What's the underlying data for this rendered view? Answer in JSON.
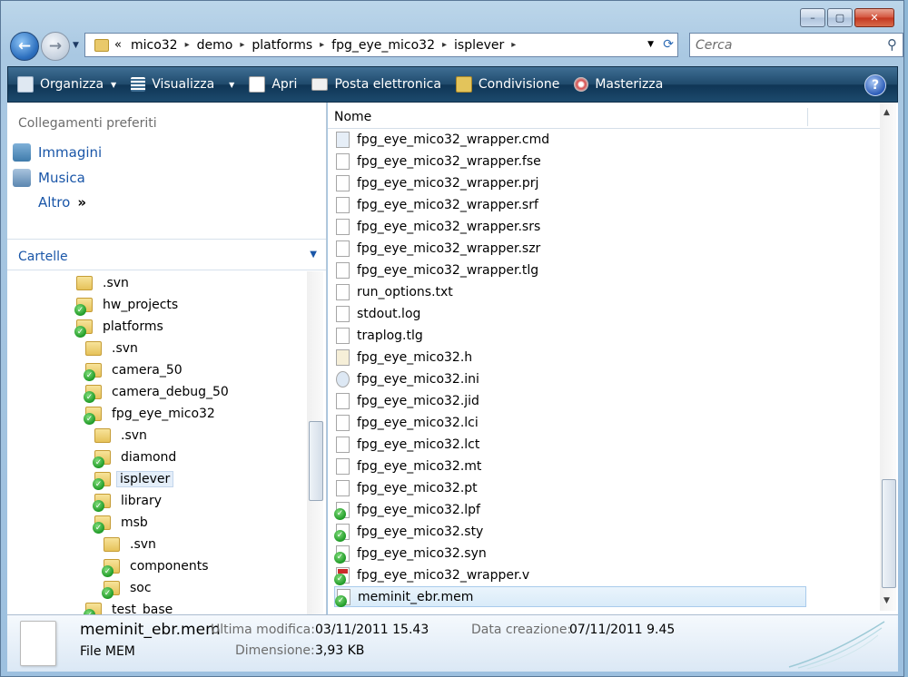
{
  "window": {
    "caption": {
      "minimize": "–",
      "maximize": "▢",
      "close": "✕"
    }
  },
  "nav": {
    "back_glyph": "←",
    "forward_glyph": "→",
    "address": {
      "root_marker": "«",
      "crumbs": [
        "mico32",
        "demo",
        "platforms",
        "fpg_eye_mico32",
        "isplever"
      ],
      "separator": "▸"
    },
    "refresh_glyph": "⟳",
    "search_placeholder": "Cerca"
  },
  "toolbar": {
    "items": [
      {
        "label": "Organizza",
        "icon": "organize-icon",
        "has_menu": true
      },
      {
        "label": "Visualizza",
        "icon": "views-icon",
        "has_menu": true
      },
      {
        "label": "Apri",
        "icon": "open-icon",
        "has_menu": false
      },
      {
        "label": "Posta elettronica",
        "icon": "email-icon",
        "has_menu": false
      },
      {
        "label": "Condivisione",
        "icon": "share-icon",
        "has_menu": false
      },
      {
        "label": "Masterizza",
        "icon": "burn-icon",
        "has_menu": false
      }
    ],
    "help": "?"
  },
  "sidebar": {
    "favorites_header": "Collegamenti preferiti",
    "favorites": [
      {
        "label": "Immagini",
        "icon": "pictures-icon"
      },
      {
        "label": "Musica",
        "icon": "music-icon"
      },
      {
        "label": "Altro",
        "icon": "more-chevron-icon",
        "suffix": "»"
      }
    ],
    "folders_header": "Cartelle",
    "tree": [
      {
        "label": ".svn",
        "depth": 0,
        "svn_ok": false
      },
      {
        "label": "hw_projects",
        "depth": 0,
        "svn_ok": true
      },
      {
        "label": "platforms",
        "depth": 0,
        "svn_ok": true
      },
      {
        "label": ".svn",
        "depth": 1,
        "svn_ok": false
      },
      {
        "label": "camera_50",
        "depth": 1,
        "svn_ok": true
      },
      {
        "label": "camera_debug_50",
        "depth": 1,
        "svn_ok": true
      },
      {
        "label": "fpg_eye_mico32",
        "depth": 1,
        "svn_ok": true
      },
      {
        "label": ".svn",
        "depth": 2,
        "svn_ok": false
      },
      {
        "label": "diamond",
        "depth": 2,
        "svn_ok": true
      },
      {
        "label": "isplever",
        "depth": 2,
        "svn_ok": true,
        "selected": true
      },
      {
        "label": "library",
        "depth": 2,
        "svn_ok": true
      },
      {
        "label": "msb",
        "depth": 2,
        "svn_ok": true
      },
      {
        "label": ".svn",
        "depth": 3,
        "svn_ok": false
      },
      {
        "label": "components",
        "depth": 3,
        "svn_ok": true
      },
      {
        "label": "soc",
        "depth": 3,
        "svn_ok": true
      },
      {
        "label": "test_base",
        "depth": 1,
        "svn_ok": true
      }
    ]
  },
  "filelist": {
    "column_name": "Nome",
    "files": [
      {
        "name": "fpg_eye_mico32_wrapper.cmd",
        "kind": "cmd"
      },
      {
        "name": "fpg_eye_mico32_wrapper.fse",
        "kind": "plain"
      },
      {
        "name": "fpg_eye_mico32_wrapper.prj",
        "kind": "plain"
      },
      {
        "name": "fpg_eye_mico32_wrapper.srf",
        "kind": "plain"
      },
      {
        "name": "fpg_eye_mico32_wrapper.srs",
        "kind": "plain"
      },
      {
        "name": "fpg_eye_mico32_wrapper.szr",
        "kind": "plain"
      },
      {
        "name": "fpg_eye_mico32_wrapper.tlg",
        "kind": "plain"
      },
      {
        "name": "run_options.txt",
        "kind": "plain"
      },
      {
        "name": "stdout.log",
        "kind": "plain"
      },
      {
        "name": "traplog.tlg",
        "kind": "plain"
      },
      {
        "name": "fpg_eye_mico32.h",
        "kind": "h"
      },
      {
        "name": "fpg_eye_mico32.ini",
        "kind": "ini"
      },
      {
        "name": "fpg_eye_mico32.jid",
        "kind": "plain"
      },
      {
        "name": "fpg_eye_mico32.lci",
        "kind": "plain"
      },
      {
        "name": "fpg_eye_mico32.lct",
        "kind": "plain"
      },
      {
        "name": "fpg_eye_mico32.mt",
        "kind": "plain"
      },
      {
        "name": "fpg_eye_mico32.pt",
        "kind": "plain"
      },
      {
        "name": "fpg_eye_mico32.lpf",
        "kind": "svn"
      },
      {
        "name": "fpg_eye_mico32.sty",
        "kind": "svn"
      },
      {
        "name": "fpg_eye_mico32.syn",
        "kind": "svn"
      },
      {
        "name": "fpg_eye_mico32_wrapper.v",
        "kind": "svn-red"
      },
      {
        "name": "meminit_ebr.mem",
        "kind": "svn",
        "selected": true
      }
    ]
  },
  "details": {
    "name": "meminit_ebr.mem",
    "type": "File MEM",
    "modified_label": "Ultima modifica:",
    "modified_value": "03/11/2011 15.43",
    "created_label": "Data creazione:",
    "created_value": "07/11/2011 9.45",
    "size_label": "Dimensione:",
    "size_value": "3,93 KB"
  },
  "colors": {
    "toolbar_bg": "#1f4a6c",
    "link_blue": "#1a56a8",
    "svn_green": "#1f9a26",
    "selection": "#d9ebf9"
  }
}
